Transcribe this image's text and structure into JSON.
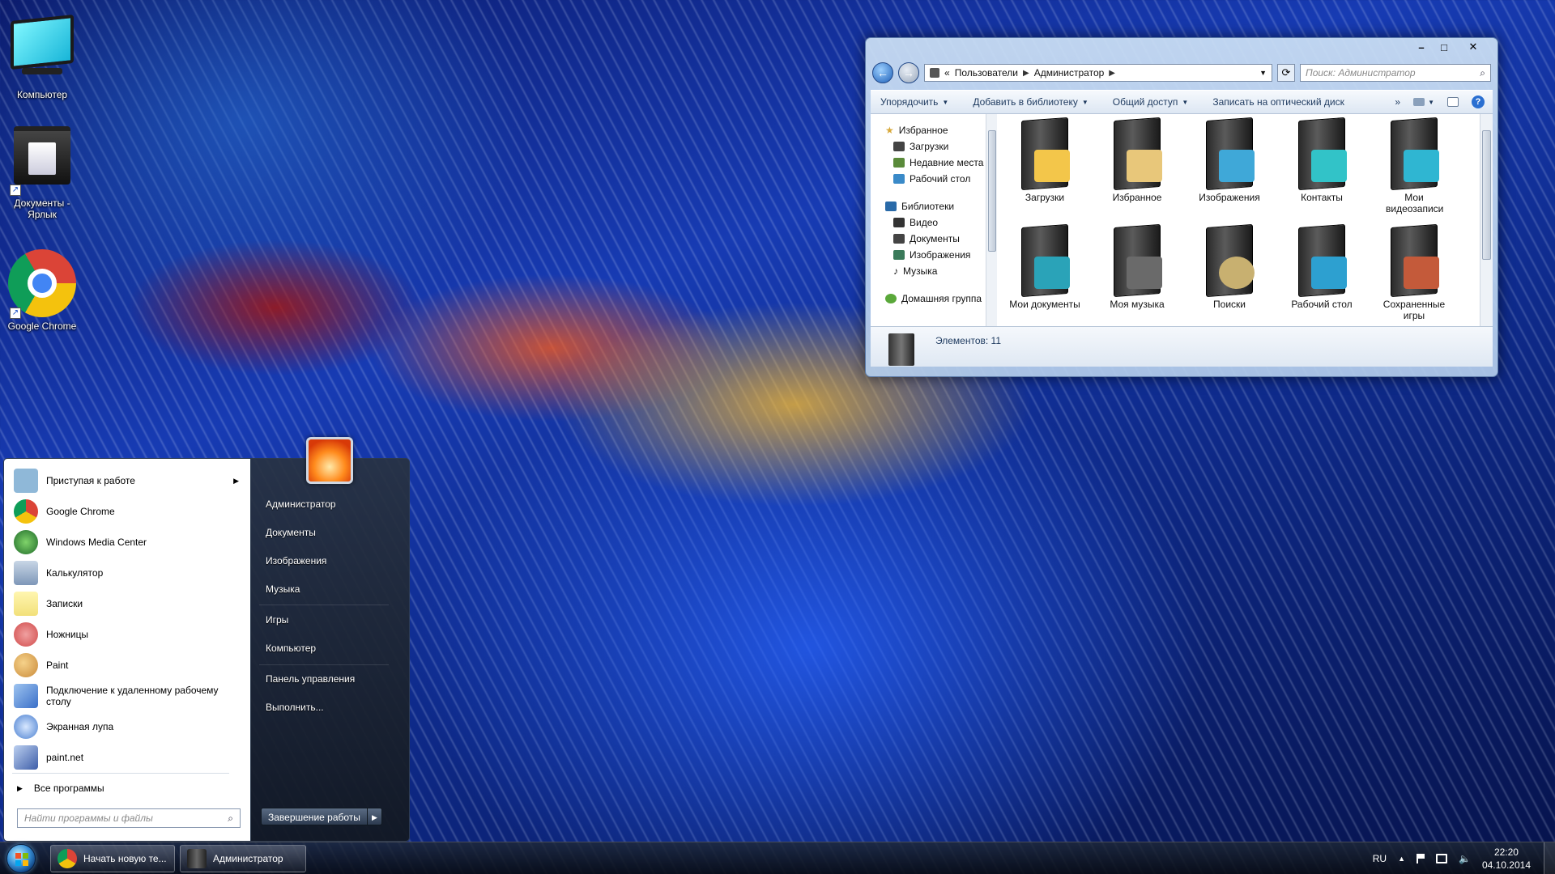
{
  "desktop": {
    "icons": [
      {
        "label": "Компьютер",
        "icon": "computer-icon"
      },
      {
        "label": "Документы -\nЯрлык",
        "icon": "documents-shortcut-icon"
      },
      {
        "label": "Google Chrome",
        "icon": "chrome-icon"
      }
    ]
  },
  "explorer": {
    "breadcrumb": [
      "«",
      "Пользователи",
      "Администратор"
    ],
    "search_placeholder": "Поиск: Администратор",
    "toolbar": {
      "organize": "Упорядочить",
      "add_to_library": "Добавить в библиотеку",
      "share": "Общий доступ",
      "burn": "Записать на оптический диск",
      "more": "»"
    },
    "nav_pane": {
      "favorites_header": "Избранное",
      "favorites": [
        "Загрузки",
        "Недавние места",
        "Рабочий стол"
      ],
      "libraries_header": "Библиотеки",
      "libraries": [
        "Видео",
        "Документы",
        "Изображения",
        "Музыка"
      ],
      "homegroup": "Домашняя группа"
    },
    "folders": [
      {
        "label": "Загрузки",
        "emblem": "#f3c64a"
      },
      {
        "label": "Избранное",
        "emblem": "#e8c77a"
      },
      {
        "label": "Изображения",
        "emblem": "#3fa8d8"
      },
      {
        "label": "Контакты",
        "emblem": "#32c3c8"
      },
      {
        "label": "Мои видеозаписи",
        "emblem": "#2fb6d2"
      },
      {
        "label": "Мои документы",
        "emblem": "#2aa3b8"
      },
      {
        "label": "Моя музыка",
        "emblem": "#6a6a6a"
      },
      {
        "label": "Поиски",
        "emblem": "#c8b070"
      },
      {
        "label": "Рабочий стол",
        "emblem": "#2da0d0"
      },
      {
        "label": "Сохраненные игры",
        "emblem": "#c45a3a"
      }
    ],
    "status": "Элементов: 11"
  },
  "start_menu": {
    "programs": [
      {
        "label": "Приступая к работе",
        "icon": "getting-started-icon",
        "color": "#8fb8d8",
        "has_arrow": true
      },
      {
        "label": "Google Chrome",
        "icon": "chrome-icon",
        "color": "#db4437"
      },
      {
        "label": "Windows Media Center",
        "icon": "media-center-icon",
        "color": "#2f8f3a"
      },
      {
        "label": "Калькулятор",
        "icon": "calculator-icon",
        "color": "#7e97b8"
      },
      {
        "label": "Записки",
        "icon": "sticky-notes-icon",
        "color": "#f2e07a"
      },
      {
        "label": "Ножницы",
        "icon": "snipping-tool-icon",
        "color": "#d04a4a"
      },
      {
        "label": "Paint",
        "icon": "paint-icon",
        "color": "#c98a3a"
      },
      {
        "label": "Подключение к удаленному рабочему столу",
        "icon": "remote-desktop-icon",
        "color": "#3a6fc8"
      },
      {
        "label": "Экранная лупа",
        "icon": "magnifier-icon",
        "color": "#4a7fd0"
      },
      {
        "label": "paint.net",
        "icon": "paintnet-icon",
        "color": "#3d5da8"
      }
    ],
    "all_programs": "Все программы",
    "search_placeholder": "Найти программы и файлы",
    "right_links": [
      "Администратор",
      "Документы",
      "Изображения",
      "Музыка",
      "Игры",
      "Компьютер",
      "Панель управления",
      "Выполнить..."
    ],
    "shutdown": "Завершение работы"
  },
  "taskbar": {
    "buttons": [
      {
        "label": "Начать новую те...",
        "icon": "chrome-icon"
      },
      {
        "label": "Администратор",
        "icon": "folder-icon"
      }
    ],
    "language": "RU",
    "time": "22:20",
    "date": "04.10.2014"
  }
}
